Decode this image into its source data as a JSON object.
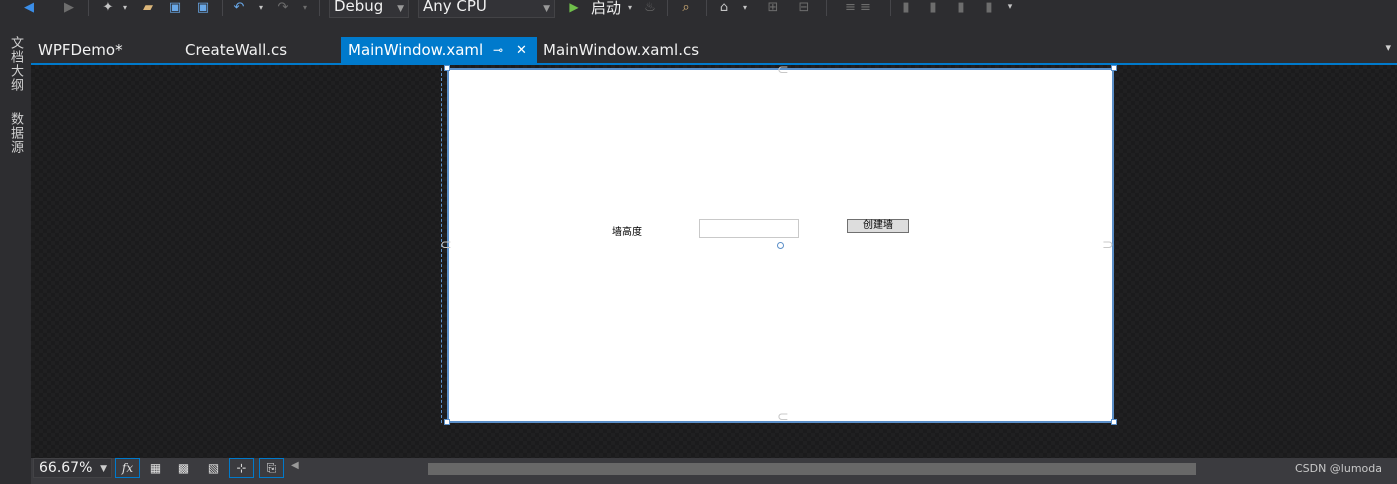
{
  "toolbar": {
    "config": "Debug",
    "platform": "Any CPU",
    "start_label": "启动",
    "icons": [
      "back-icon",
      "forward-icon",
      "new-project-icon",
      "open-folder-icon",
      "save-icon",
      "save-all-icon",
      "undo-icon",
      "redo-icon",
      "start-icon",
      "hot-reload-icon",
      "find-in-files-icon",
      "home-icon",
      "bookmark-icon"
    ]
  },
  "left_rail": {
    "items": [
      "文档大纲",
      "数据源"
    ]
  },
  "tabs": [
    {
      "label": "WPFDemo*",
      "active": false
    },
    {
      "label": "CreateWall.cs",
      "active": false
    },
    {
      "label": "MainWindow.xaml",
      "active": true
    },
    {
      "label": "MainWindow.xaml.cs",
      "active": false
    }
  ],
  "tab_icons": {
    "pin": "⊸",
    "close": "✕",
    "overflow": "▾"
  },
  "designer": {
    "label_text": "墙高度",
    "textbox_value": "",
    "button_label": "创建墙"
  },
  "bottom_bar": {
    "zoom": "66.67%",
    "fx_label": "fx",
    "watermark": "CSDN @lumoda"
  }
}
